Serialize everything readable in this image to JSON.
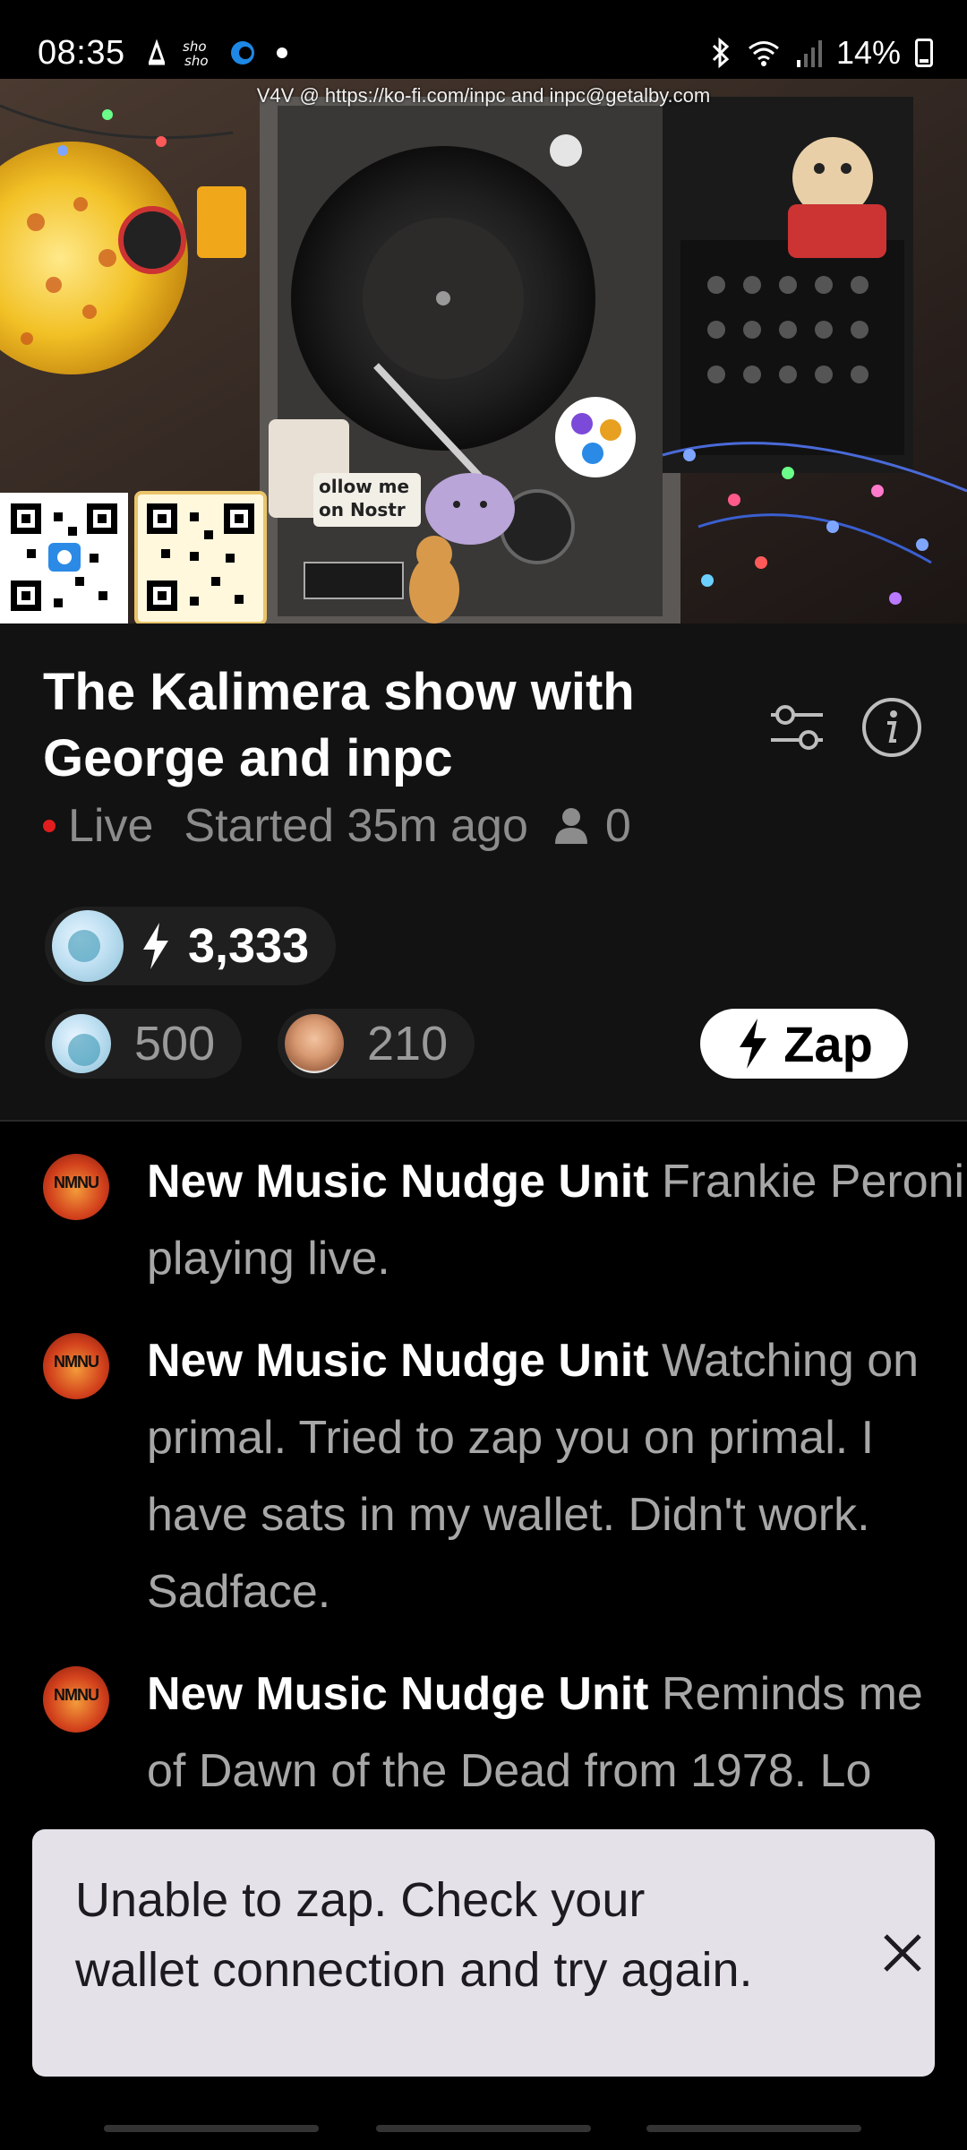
{
  "status": {
    "time": "08:35",
    "left_icons": [
      "notification-icon",
      "app-shosho-icon",
      "app-circle-icon",
      "dot-icon"
    ],
    "battery": "14%",
    "right_icons": [
      "bluetooth-icon",
      "wifi-icon",
      "signal-icon",
      "battery-icon"
    ]
  },
  "video": {
    "overlay_text": "V4V @ https://ko-fi.com/inpc and inpc@getalby.com",
    "sticker_text": "ollow me on Nostr"
  },
  "stream": {
    "title": "The Kalimera show with George and inpc",
    "live_label": "Live",
    "started": "Started 35m ago",
    "viewer_count": "0",
    "settings_icon": "sliders-icon",
    "info_icon": "info-icon"
  },
  "zaps": {
    "top_amount": "3,333",
    "pills": [
      {
        "amount": "500",
        "avatar": "bulb-avatar"
      },
      {
        "amount": "210",
        "avatar": "person-avatar"
      }
    ],
    "button_label": "Zap"
  },
  "chat": [
    {
      "author": "New Music Nudge Unit",
      "text": "Frankie Peroni playing live."
    },
    {
      "author": "New Music Nudge Unit",
      "text": "Watching on primal. Tried to zap you on primal. I have sats in my wallet. Didn't work. Sadface."
    },
    {
      "author": "New Music Nudge Unit",
      "text": "Reminds me of Dawn of the Dead from 1978. Lo"
    }
  ],
  "snackbar": {
    "message": "Unable to zap. Check your wallet connection and try again.",
    "close_icon": "close-icon"
  },
  "colors": {
    "live_dot": "#e11d1d",
    "panel_bg": "#121212",
    "snackbar_bg": "#e5e1e9"
  }
}
